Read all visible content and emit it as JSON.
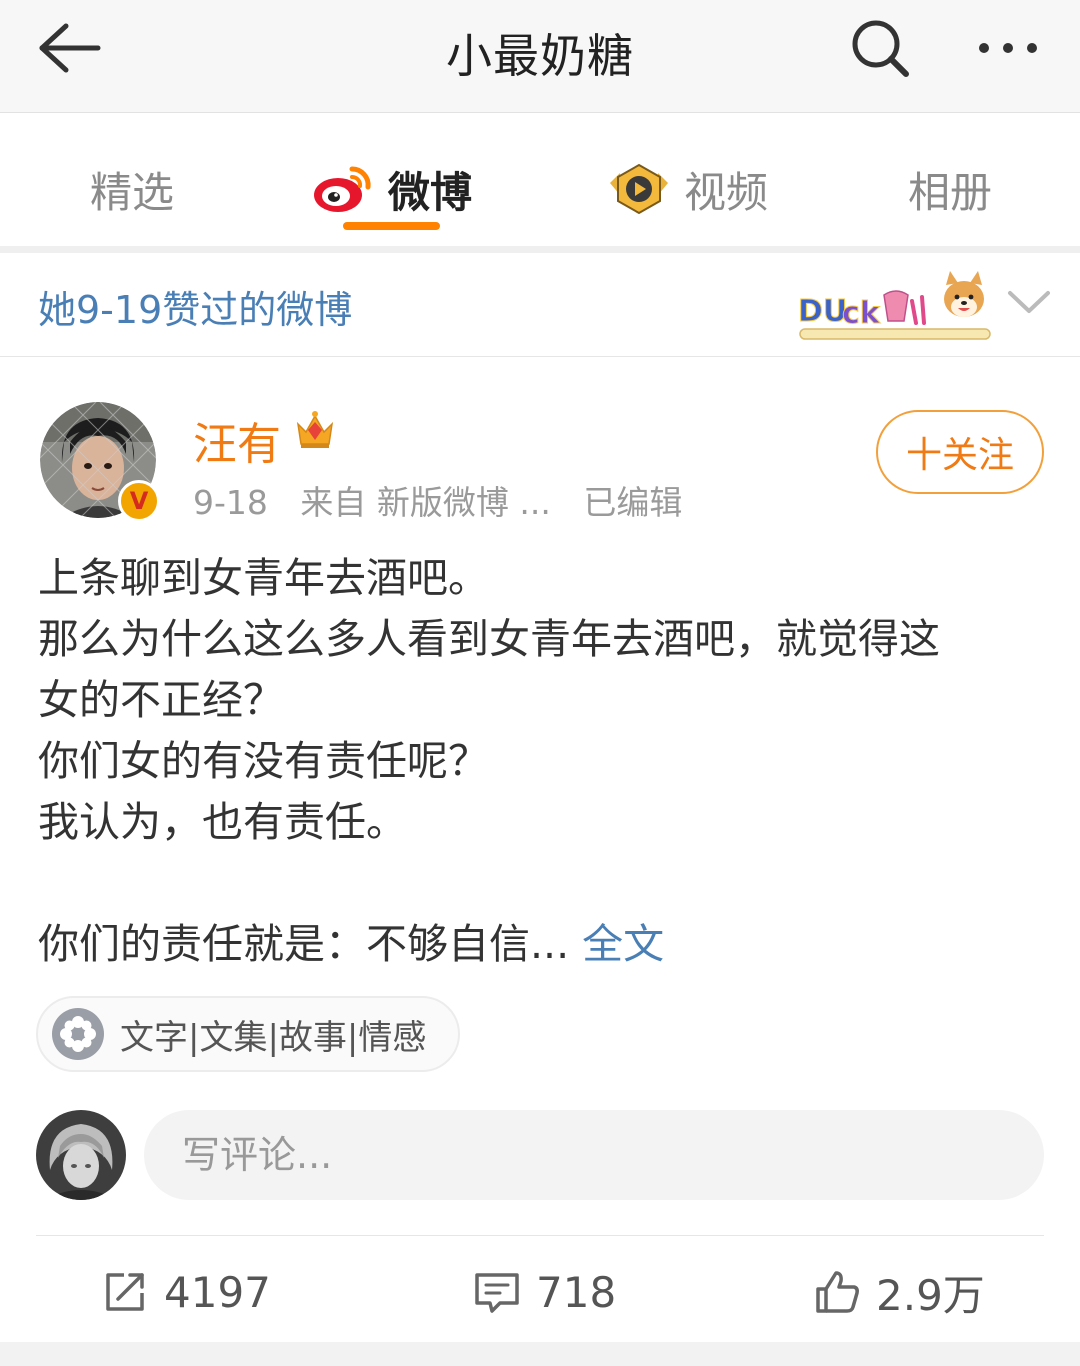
{
  "topbar": {
    "title": "小最奶糖",
    "back_icon": "back-arrow-icon",
    "search_icon": "search-icon",
    "more_icon": "more-dots-icon"
  },
  "tabs": [
    {
      "label": "精选",
      "active": false
    },
    {
      "label": "微博",
      "active": true,
      "icon": "weibo-logo-icon"
    },
    {
      "label": "视频",
      "active": false,
      "icon": "video-play-icon"
    },
    {
      "label": "相册",
      "active": false
    }
  ],
  "liked_header": {
    "title": "她9-19赞过的微博",
    "badge_icon": "duck-shiba-sticker-icon",
    "chevron_icon": "chevron-down-icon"
  },
  "post": {
    "author": "汪有",
    "verified_badge": "V",
    "crown_icon": "crown-icon",
    "date": "9-18",
    "source": "来自 新版微博 ...",
    "edited": "已编辑",
    "follow_label": "十关注",
    "body_lines": [
      "上条聊到女青年去酒吧。",
      "那么为什么这么多人看到女青年去酒吧，就觉得这",
      "女的不正经？",
      "你们女的有没有责任呢？",
      "我认为，也有责任。",
      "",
      "你们的责任就是：不够自信..."
    ],
    "full_text_link": "全文",
    "topic": "文字|文集|故事|情感"
  },
  "comment": {
    "placeholder": "写评论..."
  },
  "actions": {
    "repost_count": "4197",
    "comment_count": "718",
    "like_count": "2.9万"
  },
  "colors": {
    "accent_orange": "#ff8200",
    "author_orange": "#f07a14",
    "link_blue": "#4a7fb6",
    "muted_gray": "#9a9a9a"
  }
}
